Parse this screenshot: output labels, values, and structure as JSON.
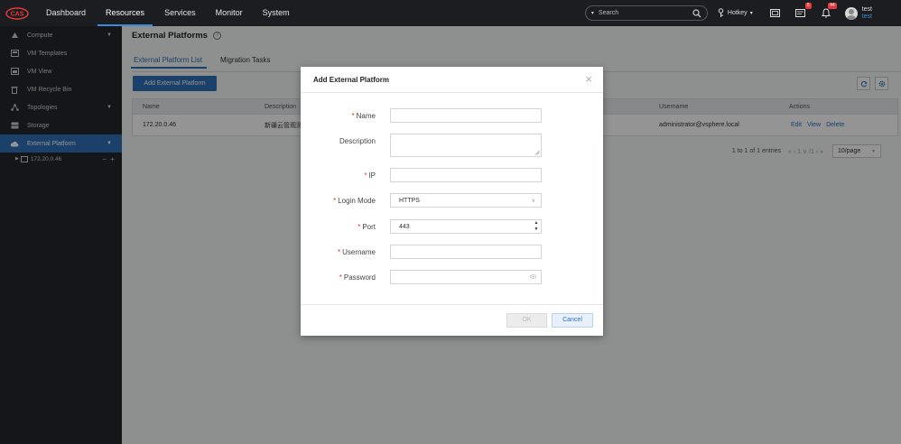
{
  "topbar": {
    "logo_text": "CAS",
    "nav": [
      "Dashboard",
      "Resources",
      "Services",
      "Monitor",
      "System"
    ],
    "active_nav": "Resources",
    "search_placeholder": "Search",
    "hotkey_label": "Hotkey",
    "badges": {
      "tasks": "5",
      "alarms": "44"
    },
    "user": {
      "name": "test",
      "role": "test"
    },
    "icons": [
      "search-icon",
      "hotkey-icon",
      "fullscreen-icon",
      "tasks-icon",
      "bell-icon",
      "avatar-icon"
    ]
  },
  "sidebar": {
    "items": [
      {
        "label": "Compute",
        "icon": "compute-icon",
        "expand": true
      },
      {
        "label": "VM Templates",
        "icon": "template-icon"
      },
      {
        "label": "VM View",
        "icon": "vm-view-icon"
      },
      {
        "label": "VM Recycle Bin",
        "icon": "trash-icon"
      },
      {
        "label": "Topologies",
        "icon": "topology-icon",
        "expand": true
      },
      {
        "label": "Storage",
        "icon": "storage-icon"
      },
      {
        "label": "External Platform",
        "icon": "cloud-icon",
        "expand": true,
        "active": true
      }
    ],
    "sub_item": {
      "label": "172.20.0.46",
      "controls": "− +"
    }
  },
  "main": {
    "title": "External Platforms",
    "tabs": [
      "External Platform List",
      "Migration Tasks"
    ],
    "add_button": "Add External Platform",
    "table": {
      "headers": [
        "Name",
        "Description",
        "Username",
        "Actions"
      ],
      "rows": [
        {
          "name": "172.20.0.46",
          "description": "新疆云管观测",
          "username": "administrator@vsphere.local",
          "actions": [
            "Edit",
            "View",
            "Delete"
          ]
        }
      ]
    },
    "pager": {
      "summary": "1 to 1 of 1 entries",
      "nav": "«  ‹  1 ∨ /1  ›  »",
      "page_size": "10/page"
    }
  },
  "modal": {
    "title": "Add External Platform",
    "close": "×",
    "fields": {
      "name": {
        "label": "Name",
        "required": true,
        "value": ""
      },
      "description": {
        "label": "Description",
        "required": false,
        "value": ""
      },
      "ip": {
        "label": "IP",
        "required": true,
        "value": ""
      },
      "login_mode": {
        "label": "Login Mode",
        "required": true,
        "value": "HTTPS"
      },
      "port": {
        "label": "Port",
        "required": true,
        "value": "443"
      },
      "username": {
        "label": "Username",
        "required": true,
        "value": ""
      },
      "password": {
        "label": "Password",
        "required": true,
        "value": ""
      }
    },
    "ok_label": "OK",
    "cancel_label": "Cancel",
    "required_mark": "*"
  },
  "colors": {
    "accent": "#2f6fb5",
    "topbar": "#1c1d21",
    "sidebar": "#24262b",
    "required": "#e5393b"
  }
}
